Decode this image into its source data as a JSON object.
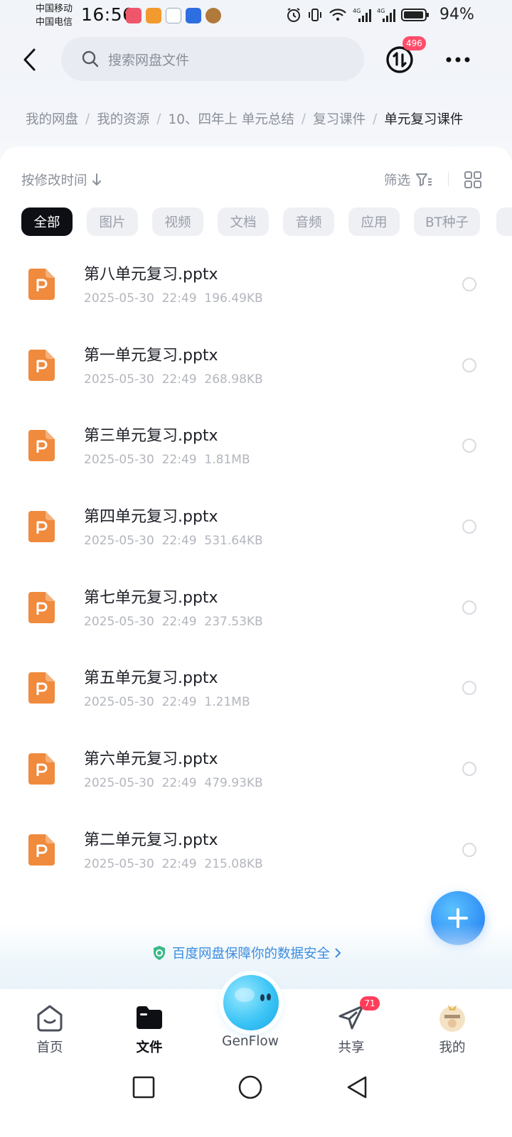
{
  "status_bar": {
    "carrier1": "中国移动",
    "carrier2": "中国电信",
    "time": "16:56",
    "network1": "4G",
    "network2": "4G",
    "battery": "94%"
  },
  "header": {
    "search_placeholder": "搜索网盘文件",
    "transfer_badge": "496"
  },
  "breadcrumb": [
    "我的网盘",
    "我的资源",
    "10、四年上 单元总结",
    "复习课件",
    "单元复习课件"
  ],
  "toolbar": {
    "sort_label": "按修改时间",
    "filter_label": "筛选"
  },
  "chips": [
    "全部",
    "图片",
    "视频",
    "文档",
    "音频",
    "应用",
    "BT种子"
  ],
  "files": [
    {
      "name": "第八单元复习.pptx",
      "date": "2025-05-30",
      "time": "22:49",
      "size": "196.49KB"
    },
    {
      "name": "第一单元复习.pptx",
      "date": "2025-05-30",
      "time": "22:49",
      "size": "268.98KB"
    },
    {
      "name": "第三单元复习.pptx",
      "date": "2025-05-30",
      "time": "22:49",
      "size": "1.81MB"
    },
    {
      "name": "第四单元复习.pptx",
      "date": "2025-05-30",
      "time": "22:49",
      "size": "531.64KB"
    },
    {
      "name": "第七单元复习.pptx",
      "date": "2025-05-30",
      "time": "22:49",
      "size": "237.53KB"
    },
    {
      "name": "第五单元复习.pptx",
      "date": "2025-05-30",
      "time": "22:49",
      "size": "1.21MB"
    },
    {
      "name": "第六单元复习.pptx",
      "date": "2025-05-30",
      "time": "22:49",
      "size": "479.93KB"
    },
    {
      "name": "第二单元复习.pptx",
      "date": "2025-05-30",
      "time": "22:49",
      "size": "215.08KB"
    }
  ],
  "security_banner": "百度网盘保障你的数据安全",
  "tabs": {
    "home": "首页",
    "files": "文件",
    "genflow": "GenFlow",
    "share": "共享",
    "share_badge": "71",
    "me": "我的"
  },
  "colors": {
    "accent": "#2f8df5",
    "ppt_orange": "#f08a3c",
    "badge_red": "#ff4d6a",
    "chip_active": "#0d0f14"
  },
  "icons": [
    "back-arrow-icon",
    "search-icon",
    "transfer-icon",
    "more-dots-icon",
    "sort-arrow-icon",
    "filter-icon",
    "grid-view-icon",
    "ppt-file-icon",
    "plus-icon",
    "shield-icon",
    "chevron-right-icon",
    "home-icon",
    "folder-icon",
    "share-icon",
    "avatar-icon",
    "square-nav-icon",
    "circle-nav-icon",
    "triangle-nav-icon"
  ]
}
